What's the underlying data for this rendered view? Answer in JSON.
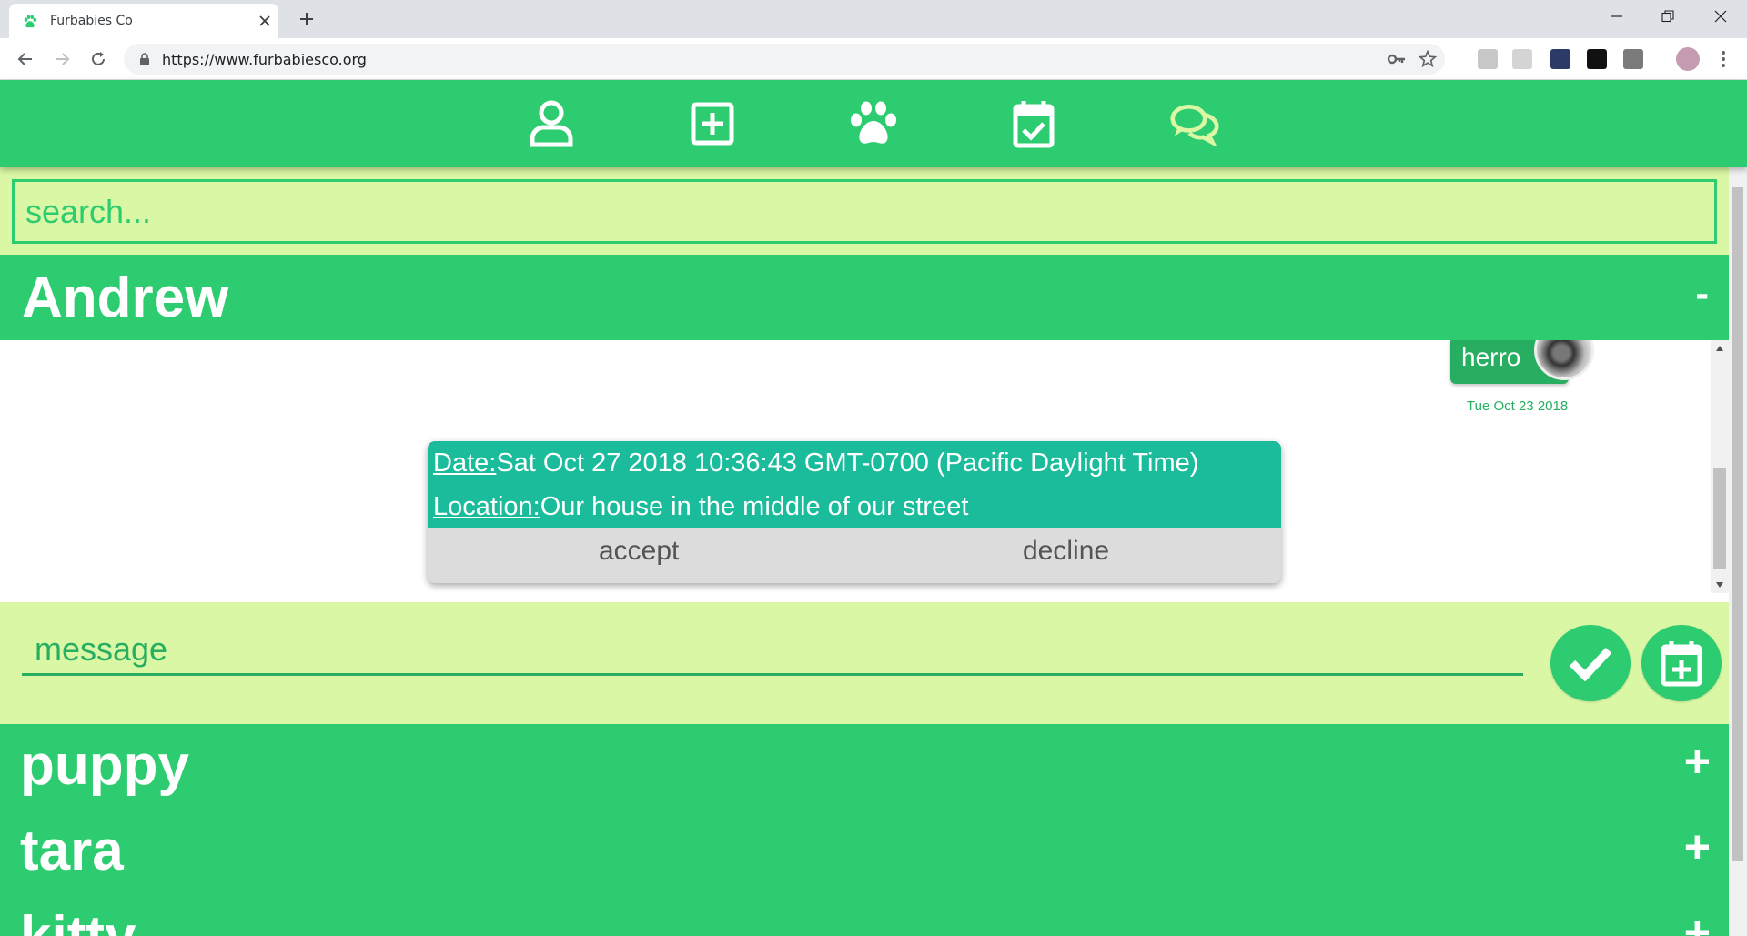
{
  "browser": {
    "tab_title": "Furbabies Co",
    "url": "https://www.furbabiesco.org"
  },
  "app": {
    "nav": [
      {
        "name": "profile",
        "icon": "user-icon"
      },
      {
        "name": "add",
        "icon": "plus-square-icon"
      },
      {
        "name": "pets",
        "icon": "paw-icon"
      },
      {
        "name": "events",
        "icon": "calendar-check-icon"
      },
      {
        "name": "messages",
        "icon": "chat-bubbles-icon",
        "active": true
      }
    ],
    "colors": {
      "primary": "#2ecc71",
      "dark": "#27ae60",
      "light": "#d9f7a4",
      "teal": "#1abc9c",
      "active_icon": "#d9f7a4"
    }
  },
  "search": {
    "placeholder": "search..."
  },
  "active_conversation": {
    "name": "Andrew",
    "toggle": "-",
    "message": {
      "text": "herro",
      "date": "Tue Oct 23 2018"
    },
    "event": {
      "date_label": "Date:",
      "date_value": "Sat Oct 27 2018 10:36:43 GMT-0700 (Pacific Daylight Time)",
      "location_label": "Location:",
      "location_value": "Our house in the middle of our street",
      "accept": "accept",
      "decline": "decline"
    }
  },
  "compose": {
    "placeholder": "message",
    "send_icon": "checkmark-icon",
    "event_icon": "calendar-plus-icon"
  },
  "conversations": [
    {
      "name": "puppy",
      "toggle": "+"
    },
    {
      "name": "tara",
      "toggle": "+"
    },
    {
      "name": "kitty",
      "toggle": "+"
    }
  ]
}
